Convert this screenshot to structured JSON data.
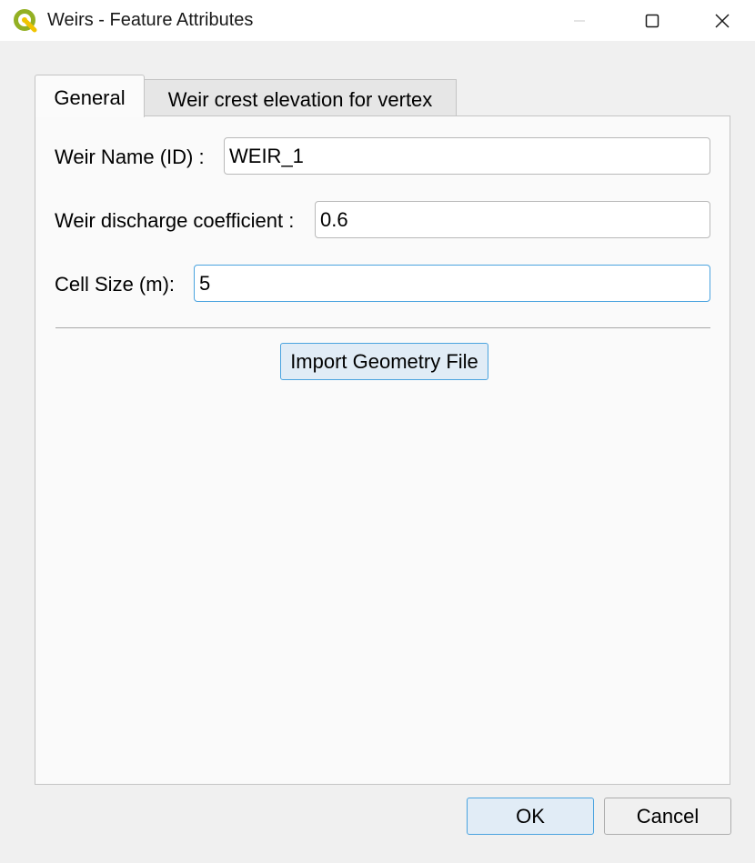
{
  "window": {
    "title": "Weirs - Feature Attributes",
    "app_icon": "qgis-logo-icon",
    "controls": [
      "minimize-icon",
      "maximize-icon",
      "close-icon"
    ]
  },
  "tabs": [
    {
      "label": "General",
      "active": true
    },
    {
      "label": "Weir crest elevation for vertex",
      "active": false
    }
  ],
  "form": {
    "weir_name": {
      "label": "Weir Name (ID) :",
      "value": "WEIR_1"
    },
    "discharge_coefficient": {
      "label": "Weir discharge coefficient :",
      "value": "0.6"
    },
    "cell_size": {
      "label": "Cell Size (m):",
      "value": "5"
    }
  },
  "buttons": {
    "import": "Import Geometry File",
    "ok": "OK",
    "cancel": "Cancel"
  },
  "colors": {
    "accent": "#4aa3df",
    "button_highlight": "#e1ecf6",
    "qgis_green": "#93b023",
    "qgis_yellow": "#f0c400"
  }
}
